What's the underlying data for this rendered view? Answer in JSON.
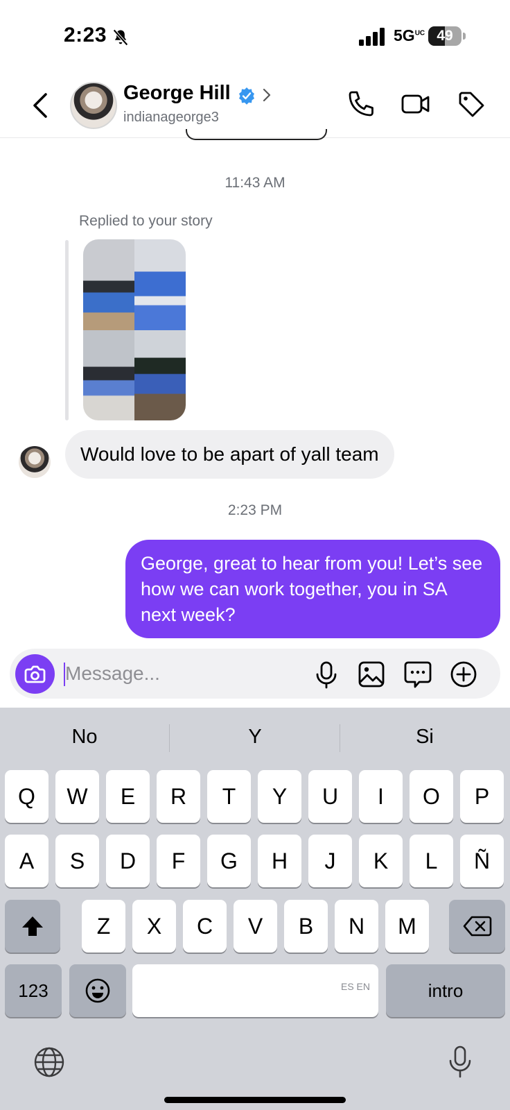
{
  "status_bar": {
    "time": "2:23",
    "network": "5G",
    "network_sup": "UC",
    "battery": "49",
    "battery_level": 0.49
  },
  "header": {
    "name": "George Hill",
    "handle": "indianageorge3"
  },
  "chat": {
    "timestamp_1": "11:43 AM",
    "replied_label": "Replied to your story",
    "incoming_message": "Would love to be apart of yall team",
    "timestamp_2": "2:23 PM",
    "outgoing_message": "George, great to hear from you! Let’s see how we can work together, you in SA next week?"
  },
  "composer": {
    "placeholder": "Message..."
  },
  "keyboard": {
    "suggestions": [
      "No",
      "Y",
      "Si"
    ],
    "row1": [
      "Q",
      "W",
      "E",
      "R",
      "T",
      "Y",
      "U",
      "I",
      "O",
      "P"
    ],
    "row2": [
      "A",
      "S",
      "D",
      "F",
      "G",
      "H",
      "J",
      "K",
      "L",
      "Ñ"
    ],
    "row3": [
      "Z",
      "X",
      "C",
      "V",
      "B",
      "N",
      "M"
    ],
    "numbers_key": "123",
    "space_lang": "ES EN",
    "return_key": "intro"
  }
}
